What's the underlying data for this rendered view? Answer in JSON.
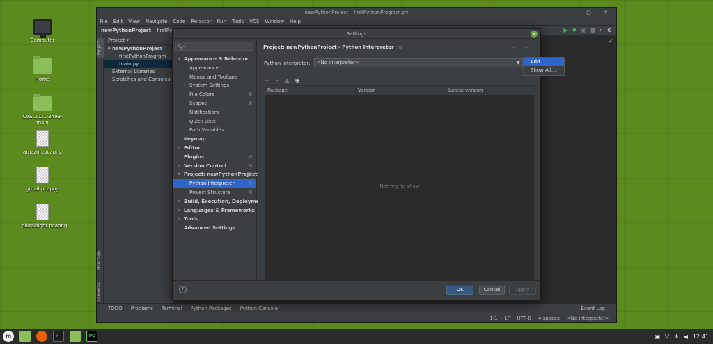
{
  "desktop": {
    "icons": [
      {
        "label": "Computer"
      },
      {
        "label": "Home"
      },
      {
        "label": "CVE-2021-3493-main"
      },
      {
        "label": "amazon.pcapng"
      },
      {
        "label": "gmail.pcapng"
      },
      {
        "label": "pluralsight.pcapng"
      }
    ]
  },
  "ide": {
    "title": "newPythonProject – firstPythonProgram.py",
    "menu": [
      "File",
      "Edit",
      "View",
      "Navigate",
      "Code",
      "Refactor",
      "Run",
      "Tools",
      "VCS",
      "Window",
      "Help"
    ],
    "breadcrumb_project": "newPythonProject",
    "breadcrumb_file": "firstPyth...",
    "project_panel_title": "Project",
    "tree": [
      "newPythonProject",
      "firstPythonProgram",
      "main.py",
      "External Libraries",
      "Scratches and Consoles"
    ],
    "vertical_tabs": {
      "project": "Project",
      "structure": "Structure",
      "favorites": "Favorites"
    },
    "bottom_tabs": [
      "TODO",
      "Problems",
      "Terminal",
      "Python Packages",
      "Python Console"
    ],
    "event_log": "Event Log",
    "status": [
      "1:1",
      "LF",
      "UTF-8",
      "4 spaces",
      "<No interpreter>"
    ]
  },
  "settings": {
    "title": "Settings",
    "search_placeholder": "Q-",
    "nav": [
      {
        "label": "Appearance & Behavior",
        "bold": true,
        "arrow": "down"
      },
      {
        "label": "Appearance",
        "indent": 2
      },
      {
        "label": "Menus and Toolbars",
        "indent": 2
      },
      {
        "label": "System Settings",
        "indent": 2,
        "arrow": "right"
      },
      {
        "label": "File Colors",
        "indent": 2,
        "gear": true
      },
      {
        "label": "Scopes",
        "indent": 2,
        "gear": true
      },
      {
        "label": "Notifications",
        "indent": 2
      },
      {
        "label": "Quick Lists",
        "indent": 2
      },
      {
        "label": "Path Variables",
        "indent": 2
      },
      {
        "label": "Keymap",
        "bold": true
      },
      {
        "label": "Editor",
        "bold": true,
        "arrow": "right"
      },
      {
        "label": "Plugins",
        "bold": true,
        "gear": true
      },
      {
        "label": "Version Control",
        "bold": true,
        "arrow": "right",
        "gear": true
      },
      {
        "label": "Project: newPythonProject",
        "bold": true,
        "arrow": "down",
        "gear": true
      },
      {
        "label": "Python Interpreter",
        "indent": 2,
        "gear": true,
        "selected": true
      },
      {
        "label": "Project Structure",
        "indent": 2,
        "gear": true
      },
      {
        "label": "Build, Execution, Deployment",
        "bold": true,
        "arrow": "right"
      },
      {
        "label": "Languages & Frameworks",
        "bold": true,
        "arrow": "right"
      },
      {
        "label": "Tools",
        "bold": true,
        "arrow": "right"
      },
      {
        "label": "Advanced Settings",
        "bold": true
      }
    ],
    "breadcrumb": "Project: newPythonProject  ›  Python Interpreter",
    "interpreter_label": "Python Interpreter:",
    "interpreter_value": "<No interpreter>",
    "popup": [
      "Add...",
      "Show All..."
    ],
    "columns": [
      "Package",
      "Version",
      "Latest version"
    ],
    "empty_text": "Nothing to show",
    "buttons": {
      "ok": "OK",
      "cancel": "Cancel",
      "apply": "Apply"
    }
  },
  "taskbar": {
    "clock": "12:41",
    "terminal_label": ">_",
    "pycharm_label": "PC"
  }
}
